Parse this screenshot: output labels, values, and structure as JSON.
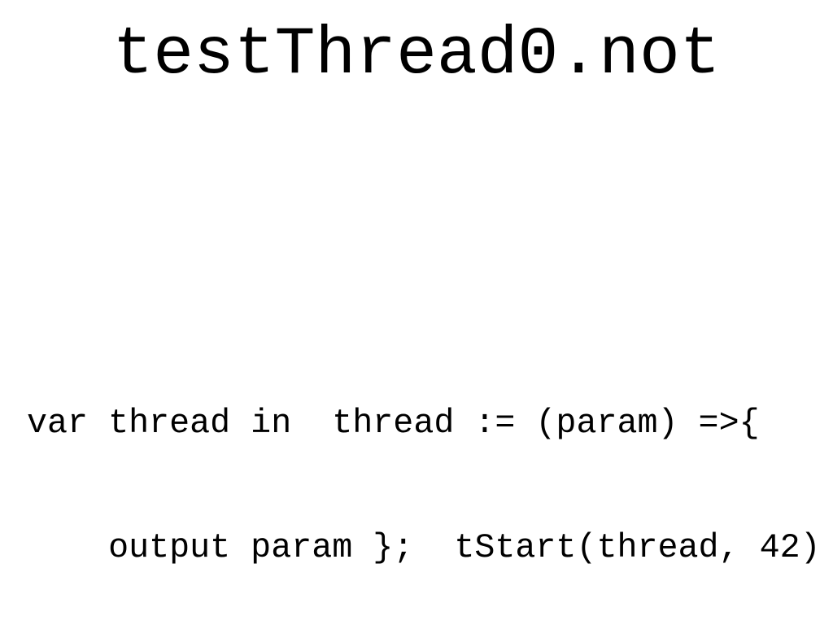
{
  "slide": {
    "title": "testThread0.not",
    "code_lines": [
      "var thread in  thread := (param) =>{",
      "    output param };  tStart(thread, 42)"
    ]
  }
}
